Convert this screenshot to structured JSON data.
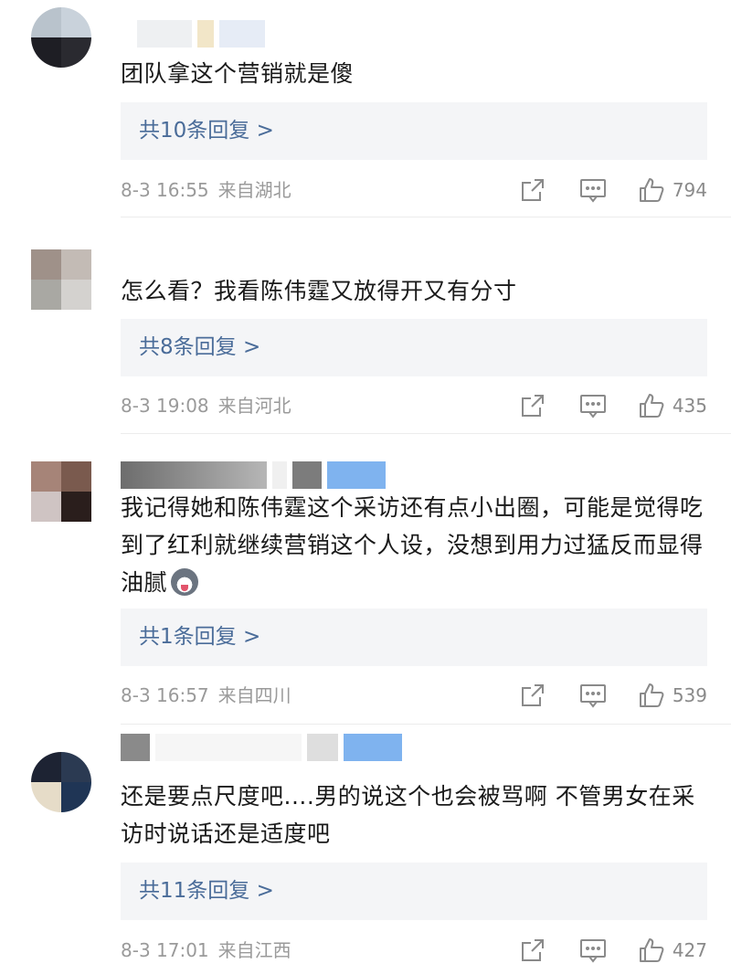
{
  "comments": [
    {
      "text": "团队拿这个营销就是傻",
      "replies_label": "共10条回复 >",
      "date": "8-3 16:55",
      "location": "来自湖北",
      "likes": "794"
    },
    {
      "text": "怎么看？我看陈伟霆又放得开又有分寸",
      "replies_label": "共8条回复 >",
      "date": "8-3 19:08",
      "location": "来自河北",
      "likes": "435"
    },
    {
      "text": "我记得她和陈伟霆这个采访还有点小出圈，可能是觉得吃到了红利就继续营销这个人设，没想到用力过猛反而显得油腻",
      "replies_label": "共1条回复 >",
      "date": "8-3 16:57",
      "location": "来自四川",
      "likes": "539"
    },
    {
      "text": "还是要点尺度吧....男的说这个也会被骂啊 不管男女在采访时说话还是适度吧",
      "replies_label": "共11条回复 >",
      "date": "8-3 17:01",
      "location": "来自江西",
      "likes": "427"
    }
  ],
  "icons": {
    "share": "share-icon",
    "reply": "comment-icon",
    "like": "thumbs-up-icon",
    "emoji": "husky-emoji-icon"
  },
  "colors": {
    "reply_link": "#4a6c99",
    "meta_text": "#9a9a9a",
    "reply_box_bg": "#f4f5f7",
    "icon_gray": "#8a8a8a"
  }
}
